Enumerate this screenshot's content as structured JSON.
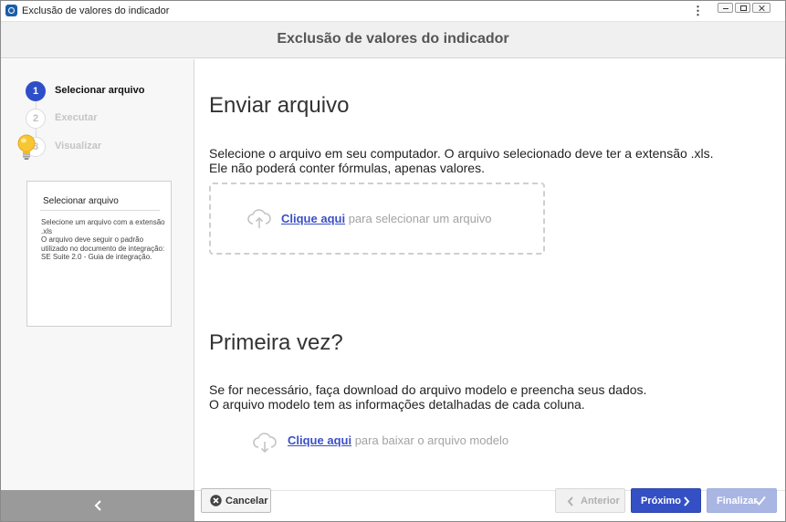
{
  "window": {
    "title": "Exclusão de valores do indicador",
    "controls": [
      "minimize",
      "maximize",
      "close"
    ]
  },
  "header": {
    "title": "Exclusão de valores do indicador"
  },
  "steps": [
    {
      "number": "1",
      "label": "Selecionar arquivo",
      "state": "active"
    },
    {
      "number": "2",
      "label": "Executar",
      "state": "inactive"
    },
    {
      "number": "3",
      "label": "Visualizar",
      "state": "inactive"
    }
  ],
  "help": {
    "title": "Selecionar arquivo",
    "text": "Selecione um arquivo com a extensão .xls\nO arquivo deve seguir o padrão utilizado no documento de integração: SE Suite 2.0 - Guia de integração."
  },
  "upload": {
    "heading": "Enviar arquivo",
    "line1": "Selecione o arquivo em seu computador. O arquivo selecionado deve ter a extensão .xls.",
    "line2": "Ele não poderá conter fórmulas, apenas valores.",
    "link": "Clique aqui",
    "link_suffix": "para selecionar um arquivo"
  },
  "first_time": {
    "heading": "Primeira vez?",
    "line1": "Se for necessário, faça download do arquivo modelo e preencha seus dados.",
    "line2": "O arquivo modelo tem as informações detalhadas de cada coluna.",
    "link": "Clique aqui",
    "link_suffix": "para baixar o arquivo modelo"
  },
  "footer": {
    "cancel": "Cancelar",
    "previous": "Anterior",
    "next": "Próximo",
    "finish": "Finalizar"
  },
  "colors": {
    "accent": "#3450c4",
    "disabled_accent": "#a9b6e4",
    "link": "#3b4fc6"
  }
}
